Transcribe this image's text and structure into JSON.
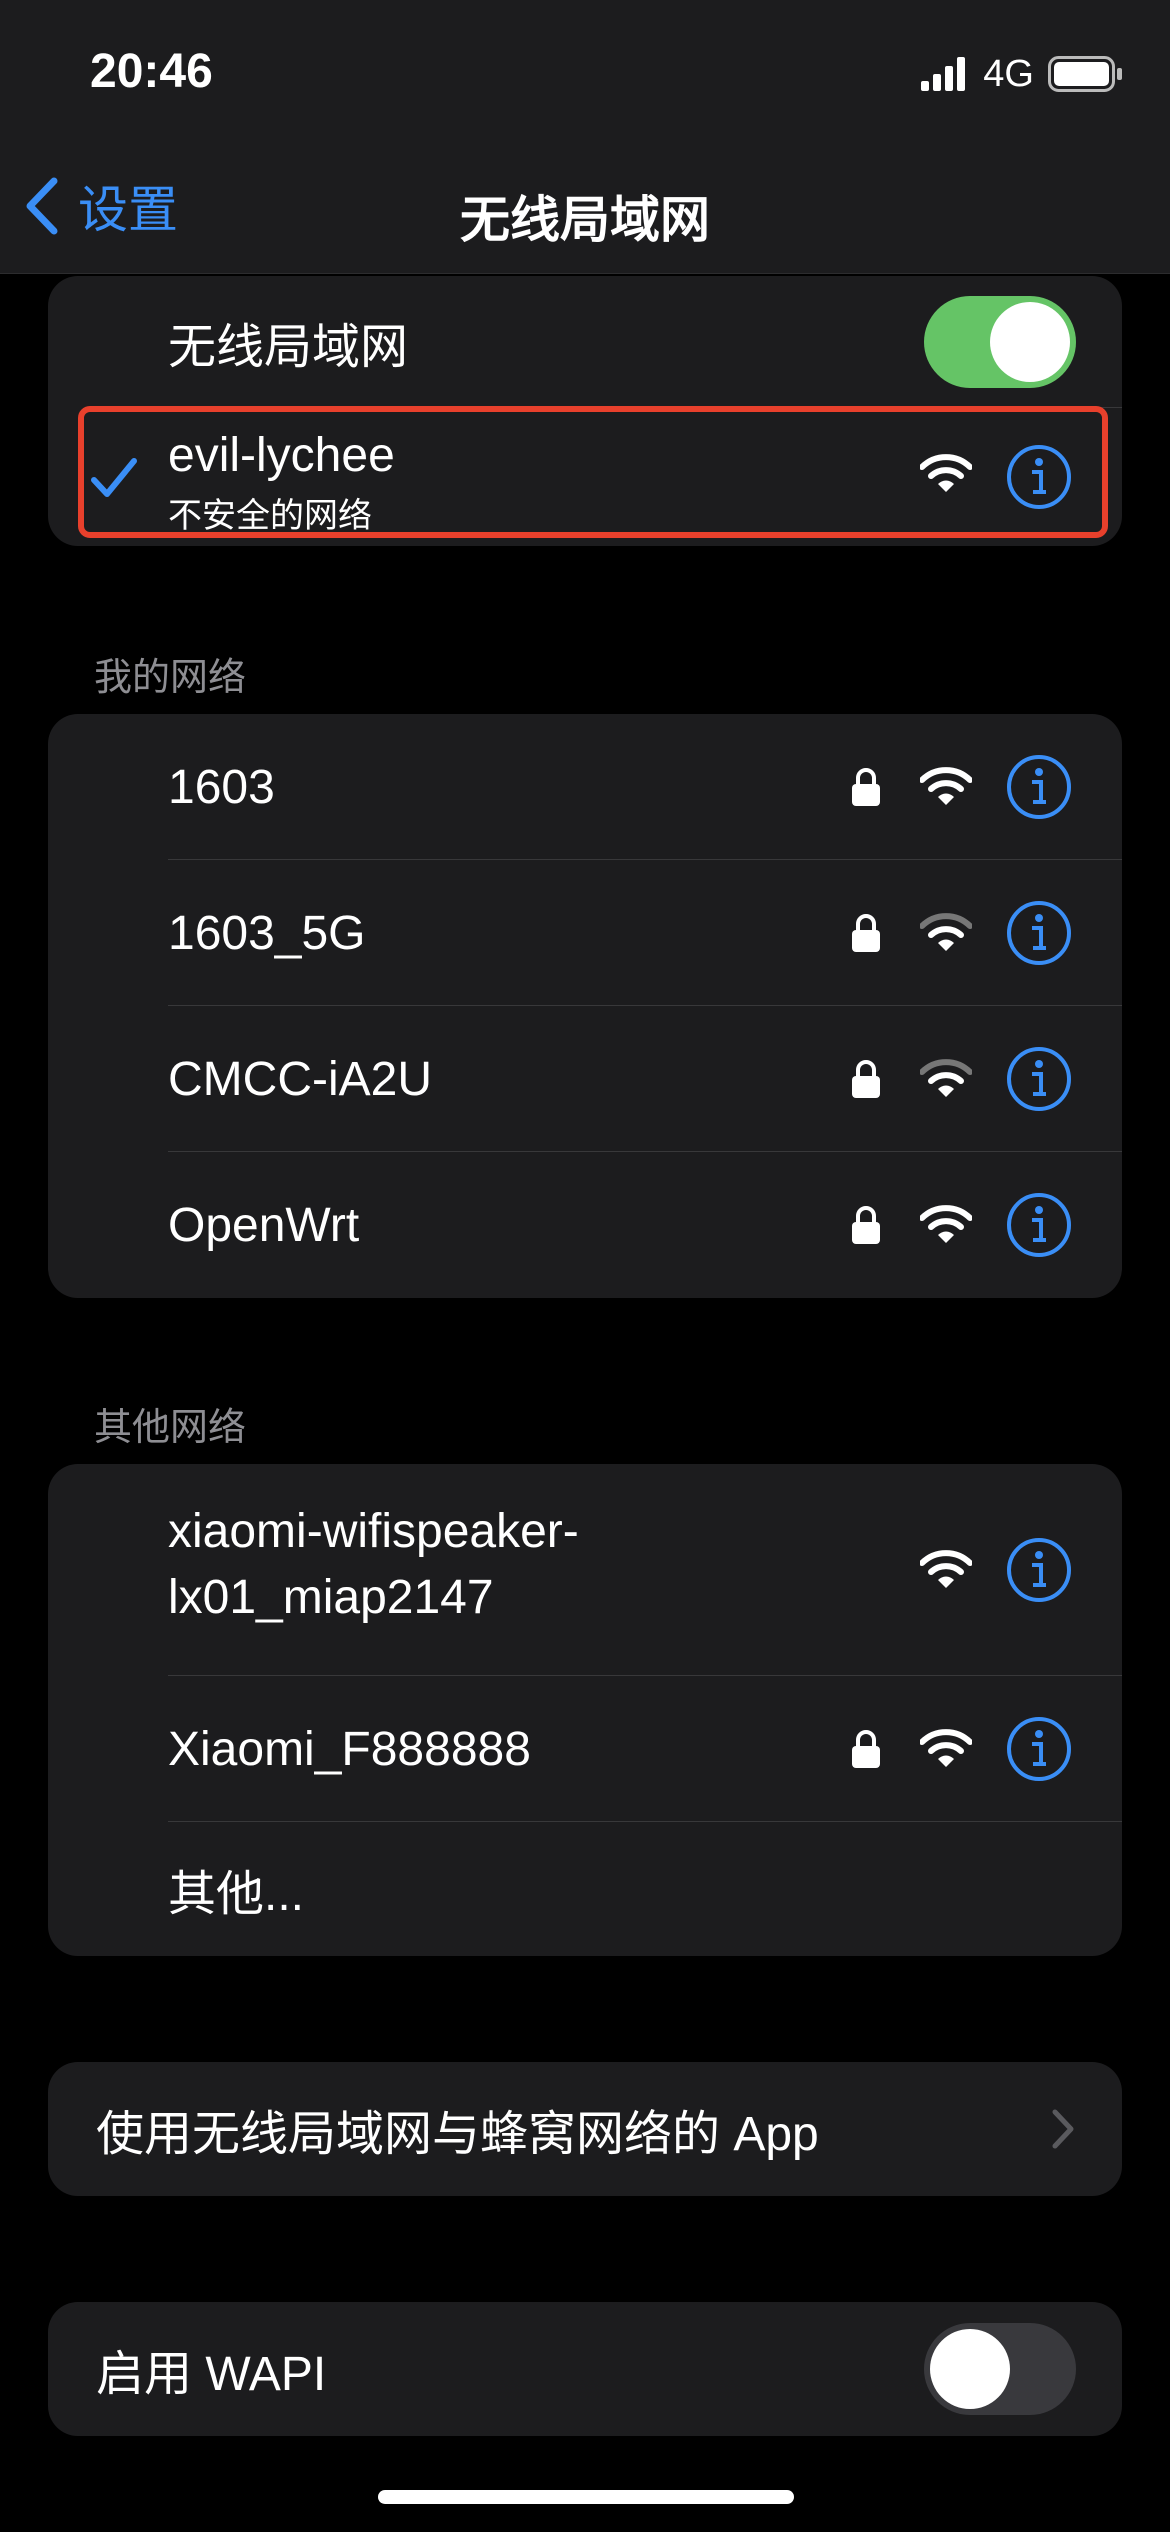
{
  "status_bar": {
    "time": "20:46",
    "network": "4G"
  },
  "nav": {
    "back_label": "设置",
    "title": "无线局域网"
  },
  "wifi_toggle": {
    "label": "无线局域网",
    "enabled": true
  },
  "current_network": {
    "name": "evil-lychee",
    "subtitle": "不安全的网络",
    "checked": true
  },
  "my_networks": {
    "header": "我的网络",
    "items": [
      {
        "name": "1603",
        "locked": true,
        "signal": "full"
      },
      {
        "name": "1603_5G",
        "locked": true,
        "signal": "weak"
      },
      {
        "name": "CMCC-iA2U",
        "locked": true,
        "signal": "weak"
      },
      {
        "name": "OpenWrt",
        "locked": true,
        "signal": "full"
      }
    ]
  },
  "other_networks": {
    "header": "其他网络",
    "items": [
      {
        "name_line1": "xiaomi-wifispeaker-",
        "name_line2": "lx01_miap2147",
        "locked": false,
        "signal": "full"
      },
      {
        "name": "Xiaomi_F888888",
        "locked": true,
        "signal": "full"
      }
    ],
    "other_label": "其他..."
  },
  "apps_row": {
    "label": "使用无线局域网与蜂窝网络的 App"
  },
  "wapi_row": {
    "label": "启用 WAPI",
    "enabled": false
  },
  "colors": {
    "accent": "#3a8ef6",
    "toggle_on": "#65c466",
    "highlight": "#e8402c"
  }
}
